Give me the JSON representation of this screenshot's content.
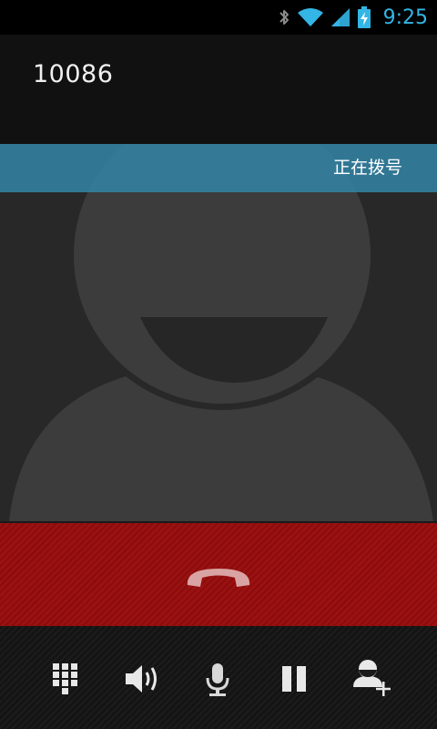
{
  "status_bar": {
    "time": "9:25",
    "icons": [
      "bluetooth-icon",
      "wifi-icon",
      "signal-icon",
      "battery-charging-icon"
    ],
    "accent_color": "#33b5e5"
  },
  "call": {
    "number": "10086",
    "state_label": "正在拨号",
    "state_banner_color": "#3385a7",
    "end_call_color": "#9b1111"
  },
  "toolbar": {
    "buttons": [
      {
        "name": "dialpad-button",
        "icon": "dialpad-icon"
      },
      {
        "name": "speaker-button",
        "icon": "speaker-icon"
      },
      {
        "name": "mute-button",
        "icon": "microphone-icon"
      },
      {
        "name": "hold-button",
        "icon": "pause-icon"
      },
      {
        "name": "add-call-button",
        "icon": "add-person-icon"
      }
    ]
  }
}
